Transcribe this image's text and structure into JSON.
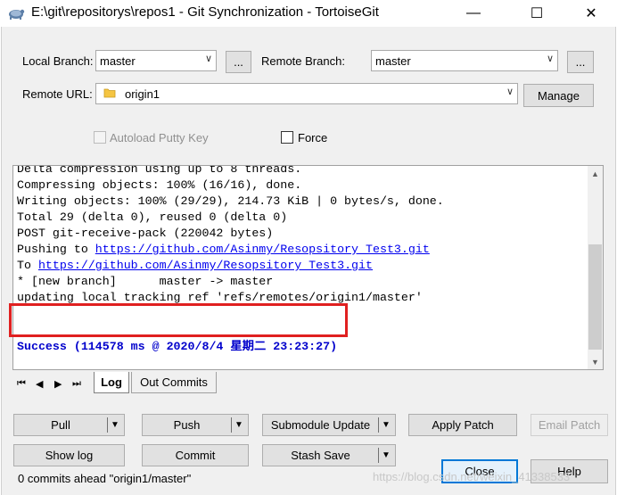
{
  "window": {
    "title": "E:\\git\\repositorys\\repos1 - Git Synchronization - TortoiseGit",
    "minimize": "—",
    "maximize": "☐",
    "close": "✕"
  },
  "form": {
    "local_branch_label": "Local Branch:",
    "local_branch_value": "master",
    "local_browse": "...",
    "remote_branch_label": "Remote Branch:",
    "remote_branch_value": "master",
    "remote_browse": "...",
    "remote_url_label": "Remote URL:",
    "remote_url_value": "origin1",
    "manage": "Manage",
    "autoload_label": "Autoload Putty Key",
    "force_label": "Force"
  },
  "log": {
    "lines": [
      {
        "text": "Delta compression using up to 8 threads."
      },
      {
        "text": "Compressing objects: 100% (16/16), done."
      },
      {
        "text": "Writing objects: 100% (29/29), 214.73 KiB | 0 bytes/s, done."
      },
      {
        "text": "Total 29 (delta 0), reused 0 (delta 0)"
      },
      {
        "text": "POST git-receive-pack (220042 bytes)"
      },
      {
        "prefix": "Pushing to ",
        "link": "https://github.com/Asinmy/Resopsitory_Test3.git"
      },
      {
        "prefix": "To ",
        "link": "https://github.com/Asinmy/Resopsitory_Test3.git"
      },
      {
        "text": "* [new branch]      master -> master"
      },
      {
        "text": "updating local tracking ref 'refs/remotes/origin1/master'"
      }
    ],
    "success": "Success (114578 ms @ 2020/8/4 星期二 23:23:27)"
  },
  "tabs": {
    "log": "Log",
    "out_commits": "Out Commits"
  },
  "buttons": {
    "pull": "Pull",
    "push": "Push",
    "submodule_update": "Submodule Update",
    "apply_patch": "Apply Patch",
    "email_patch": "Email Patch",
    "show_log": "Show log",
    "commit": "Commit",
    "stash_save": "Stash Save",
    "close": "Close",
    "help": "Help"
  },
  "status": "0 commits ahead \"origin1/master\"",
  "watermark": "https://blog.csdn.net/weixin_41338533",
  "colors": {
    "success_text": "#0000cc",
    "highlight_border": "#e02020",
    "link": "#0000ee"
  }
}
